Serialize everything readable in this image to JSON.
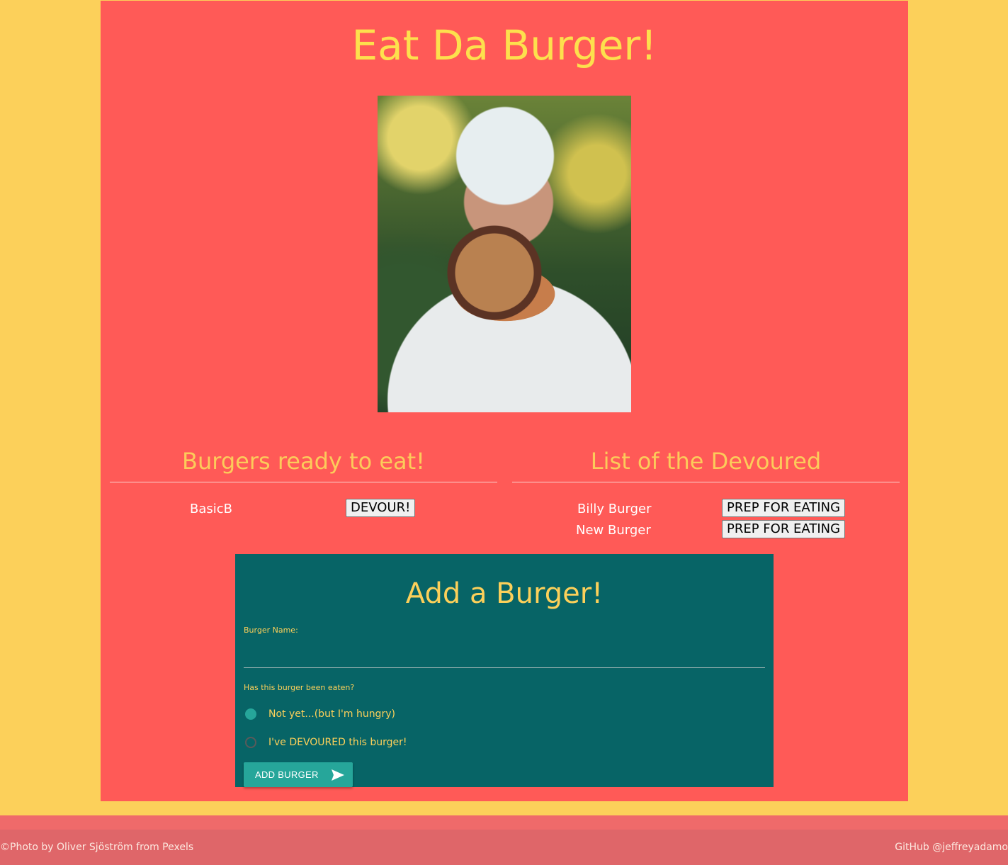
{
  "header": {
    "title": "Eat Da Burger!"
  },
  "ready": {
    "heading": "Burgers ready to eat!",
    "items": [
      {
        "name": "BasicB",
        "button": "DEVOUR!"
      }
    ]
  },
  "devoured": {
    "heading": "List of the Devoured",
    "items": [
      {
        "name": "Billy Burger",
        "button": "PREP FOR EATING"
      },
      {
        "name": "New Burger",
        "button": "PREP FOR EATING"
      }
    ]
  },
  "form": {
    "title": "Add a Burger!",
    "name_label": "Burger Name:",
    "name_value": "",
    "eaten_label": "Has this burger been eaten?",
    "options": [
      {
        "label": "Not yet...(but I'm hungry)",
        "selected": true
      },
      {
        "label": "I've DEVOURED this burger!",
        "selected": false
      }
    ],
    "submit_label": "ADD BURGER",
    "submit_icon": "send-icon"
  },
  "footer": {
    "credit": "©Photo by Oliver Sjöström from Pexels",
    "github": "GitHub @jeffreyadamo"
  },
  "colors": {
    "page_bg": "#fcd05a",
    "panel_bg": "#ff5a57",
    "title": "#fde04d",
    "form_bg": "#076466",
    "accent": "#26a69a",
    "footer_bg": "#df6669"
  }
}
